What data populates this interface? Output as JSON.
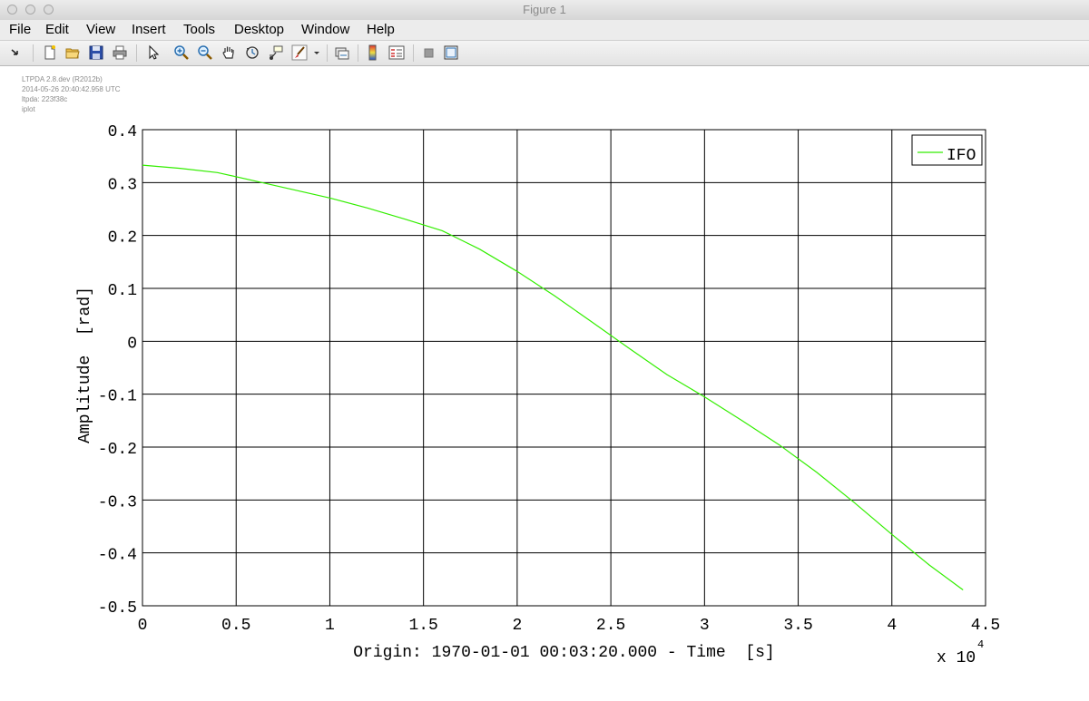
{
  "window": {
    "title": "Figure 1"
  },
  "menu": [
    "File",
    "Edit",
    "View",
    "Insert",
    "Tools",
    "Desktop",
    "Window",
    "Help"
  ],
  "toolbar": {
    "buttons": [
      "dock-arrow-icon",
      "new-figure-icon",
      "open-file-icon",
      "save-icon",
      "print-icon",
      "select-pointer-icon",
      "zoom-in-icon",
      "zoom-out-icon",
      "pan-hand-icon",
      "rotate-3d-icon",
      "data-cursor-icon",
      "brush-icon",
      "brush-dropdown-icon",
      "link-plot-icon",
      "colorbar-icon",
      "legend-icon",
      "hide-plot-tools-icon",
      "show-plot-tools-icon"
    ]
  },
  "annotation": {
    "lines": [
      "LTPDA 2.8.dev (R2012b)",
      "2014-05-26 20:40:42.958 UTC",
      "ltpda: 223f38c",
      "iplot"
    ]
  },
  "chart_data": {
    "type": "line",
    "title": "",
    "xlabel": "Origin: 1970-01-01 00:03:20.000 - Time  [s]",
    "ylabel": "Amplitude  [rad]",
    "x_exponent_label": "x 10",
    "x_exponent_power": "4",
    "xlim": [
      0,
      45000
    ],
    "ylim": [
      -0.5,
      0.4
    ],
    "xticks": [
      0,
      5000,
      10000,
      15000,
      20000,
      25000,
      30000,
      35000,
      40000,
      45000
    ],
    "xtick_labels": [
      "0",
      "0.5",
      "1",
      "1.5",
      "2",
      "2.5",
      "3",
      "3.5",
      "4",
      "4.5"
    ],
    "yticks": [
      0.4,
      0.3,
      0.2,
      0.1,
      0,
      -0.1,
      -0.2,
      -0.3,
      -0.4,
      -0.5
    ],
    "ytick_labels": [
      "0.4",
      "0.3",
      "0.2",
      "0.1",
      "0",
      "-0.1",
      "-0.2",
      "-0.3",
      "-0.4",
      "-0.5"
    ],
    "grid": true,
    "legend_position": "top-right",
    "series": [
      {
        "name": "IFO",
        "color": "#33ee00",
        "x": [
          0,
          2000,
          4000,
          6000,
          8000,
          10000,
          12000,
          14000,
          16000,
          18000,
          20000,
          22000,
          24000,
          26000,
          28000,
          30000,
          32000,
          34000,
          36000,
          38000,
          40000,
          42000,
          43800
        ],
        "y": [
          0.333,
          0.327,
          0.319,
          0.303,
          0.287,
          0.271,
          0.252,
          0.231,
          0.209,
          0.174,
          0.132,
          0.086,
          0.036,
          -0.014,
          -0.063,
          -0.105,
          -0.15,
          -0.196,
          -0.248,
          -0.305,
          -0.365,
          -0.423,
          -0.47
        ]
      }
    ]
  }
}
